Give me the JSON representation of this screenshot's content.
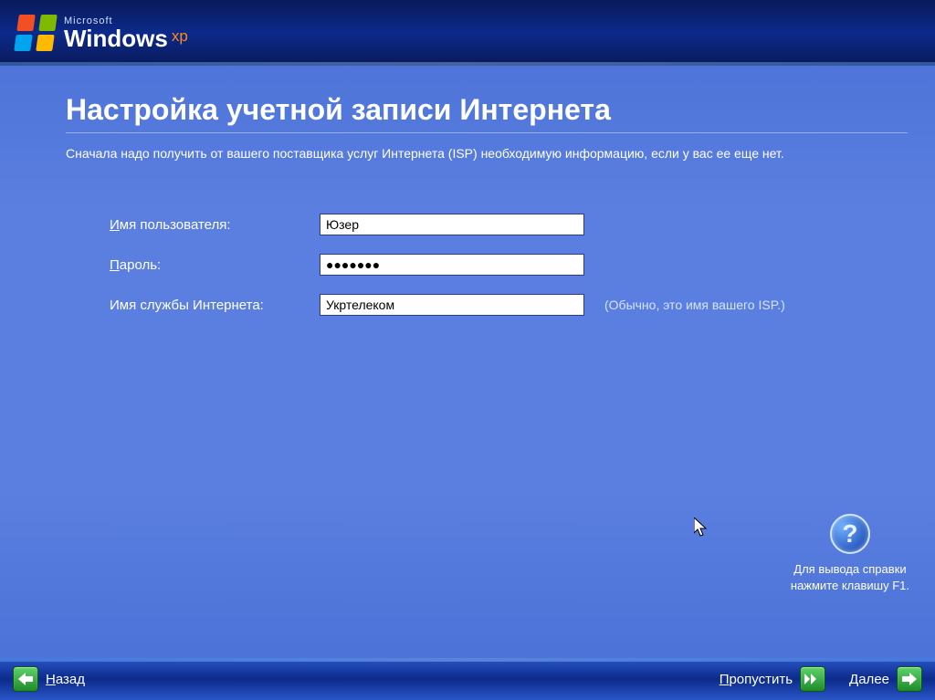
{
  "branding": {
    "company": "Microsoft",
    "product": "Windows",
    "suffix": "xp"
  },
  "page": {
    "title": "Настройка учетной записи Интернета",
    "subtitle": "Сначала надо получить от вашего поставщика услуг Интернета (ISP) необходимую информацию, если у вас ее еще нет."
  },
  "form": {
    "username": {
      "label_pre": "И",
      "label_rest": "мя пользователя:",
      "value": "Юзер"
    },
    "password": {
      "label_pre": "П",
      "label_rest": "ароль:",
      "value": "●●●●●●●"
    },
    "isp": {
      "label": "Имя службы Интернета:",
      "value": "Укртелеком",
      "hint": "(Обычно, это имя вашего ISP.)"
    }
  },
  "help": {
    "line1": "Для вывода справки",
    "line2": "нажмите клавишу F1."
  },
  "footer": {
    "back_pre": "Н",
    "back_rest": "азад",
    "skip_pre": "П",
    "skip_rest": "ропустить",
    "next_pre": "Д",
    "next_rest": "алее"
  }
}
